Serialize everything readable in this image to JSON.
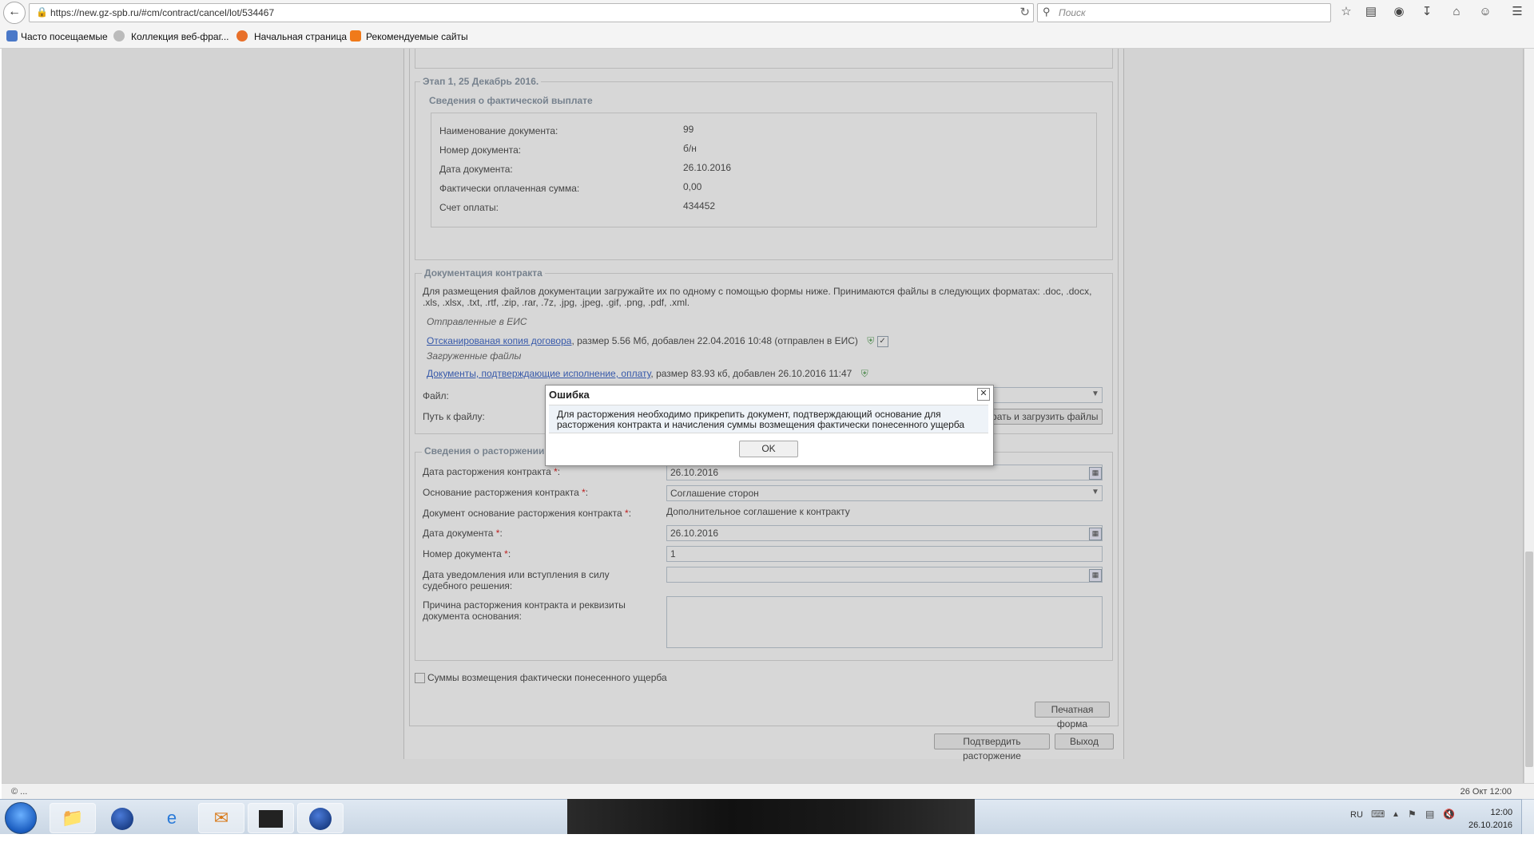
{
  "browser": {
    "url": "https://new.gz-spb.ru/#cm/contract/cancel/lot/534467",
    "search_placeholder": "Поиск",
    "bookmarks": [
      "Часто посещаемые",
      "Коллекция веб-фраг...",
      "Начальная страница",
      "Рекомендуемые сайты"
    ]
  },
  "stage": {
    "legend": "Этап 1, 25 Декабрь 2016.",
    "sub_legend": "Сведения о фактической выплате",
    "rows": [
      {
        "label": "Наименование документа:",
        "value": "99"
      },
      {
        "label": "Номер документа:",
        "value": "б/н"
      },
      {
        "label": "Дата документа:",
        "value": "26.10.2016"
      },
      {
        "label": "Фактически оплаченная сумма:",
        "value": "0,00"
      },
      {
        "label": "Счет оплаты:",
        "value": "434452"
      }
    ]
  },
  "docs": {
    "legend": "Документация контракта",
    "info": "Для размещения файлов документации загружайте их по одному с помощью формы ниже. Принимаются файлы в следующих форматах: .doc, .docx, .xls, .xlsx, .txt, .rtf, .zip, .rar, .7z, .jpg, .jpeg, .gif, .png, .pdf, .xml.",
    "sent_heading": "Отправленные в ЕИС",
    "sent_link": "Отсканированая копия договора",
    "sent_meta": ", размер 5.56 Мб, добавлен 22.04.2016 10:48 (отправлен в ЕИС)",
    "uploaded_heading": "Загруженные файлы",
    "uploaded_link": "Документы, подтверждающие исполнение, оплату",
    "uploaded_meta": ", размер 83.93 кб, добавлен 26.10.2016 11:47",
    "file_label": "Файл:",
    "path_label": "Путь к файлу:",
    "upload_button": "Выбрать и загрузить файлы"
  },
  "termination": {
    "legend": "Сведения о расторжении",
    "date_label": "Дата расторжения контракта",
    "date_value": "26.10.2016",
    "basis_label": "Основание расторжения контракта",
    "basis_value": "Соглашение сторон",
    "doc_basis_label": "Документ основание расторжения контракта",
    "doc_basis_value": "Дополнительное соглашение к контракту",
    "doc_date_label": "Дата документа",
    "doc_date_value": "26.10.2016",
    "doc_number_label": "Номер документа",
    "doc_number_value": "1",
    "notice_label_1": "Дата уведомления или вступления в силу",
    "notice_label_2": "судебного решения:",
    "reason_label_1": "Причина расторжения контракта и реквизиты",
    "reason_label_2": "документа основания:",
    "req_mark": "*",
    "colon": ":"
  },
  "damages_checkbox_label": "Суммы возмещения фактически понесенного ущерба",
  "print_button": "Печатная форма",
  "confirm_button": "Подтвердить расторжение",
  "exit_button": "Выход",
  "status": {
    "left": "© ...",
    "right": "26 Окт 12:00"
  },
  "dialog": {
    "title": "Ошибка",
    "message": "Для расторжения необходимо прикрепить документ, подтверждающий основание для расторжения контракта и начисления суммы возмещения фактически понесенного ущерба",
    "ok": "OK"
  },
  "taskbar": {
    "lang": "RU",
    "time": "12:00",
    "date": "26.10.2016"
  }
}
